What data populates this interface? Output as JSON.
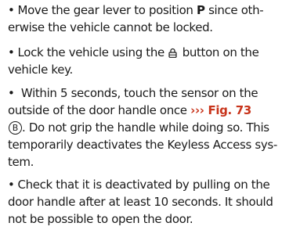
{
  "steps": [
    {
      "bullet": "•",
      "lines": [
        {
          "a": "Move the gear lever to position ",
          "b": "P",
          "c": " since oth-"
        },
        {
          "a": "erwise the vehicle cannot be locked."
        }
      ]
    },
    {
      "bullet": "•",
      "lines": [
        {
          "a": "Lock the vehicle using the ",
          "icon": "lock-icon",
          "b": " button on the"
        },
        {
          "a": "vehicle key."
        }
      ]
    },
    {
      "bullet": "•",
      "lines": [
        {
          "a": " Within 5 seconds, touch the sensor on the"
        },
        {
          "a": "outside of the door handle once ",
          "ref": "››› Fig. 73"
        },
        {
          "label": "B",
          "b": ". Do not grip the handle while doing so. This"
        },
        {
          "a": "temporarily deactivates the Keyless Access sys-"
        },
        {
          "a": "tem."
        }
      ]
    },
    {
      "bullet": "•",
      "lines": [
        {
          "a": "Check that it is deactivated by pulling on the"
        },
        {
          "a": "door handle after at least 10 seconds. It should"
        },
        {
          "a": "not be possible to open the door."
        }
      ]
    }
  ],
  "colors": {
    "text": "#1a1a1a",
    "xref": "#c8341b"
  }
}
